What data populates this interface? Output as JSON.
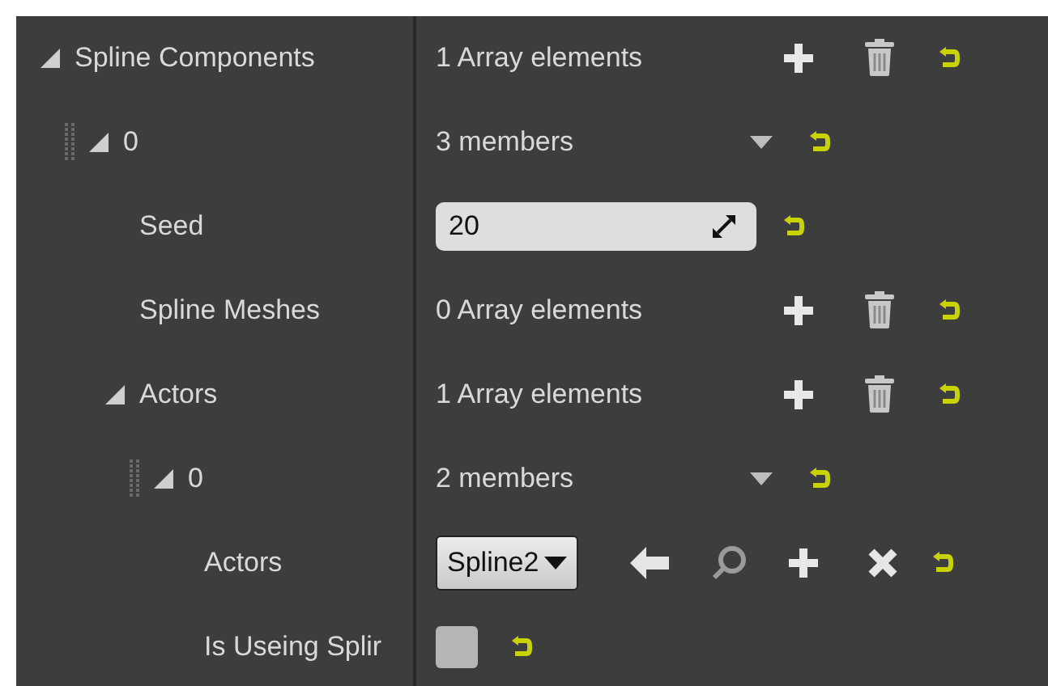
{
  "rows": [
    {
      "label": "Spline Components",
      "kind": "array",
      "expanded": true,
      "value": "1 Array elements",
      "children": [
        {
          "label": "0",
          "kind": "struct",
          "handle": true,
          "expanded": true,
          "value": "3 members",
          "children": [
            {
              "label": "Seed",
              "kind": "number",
              "value": "20"
            },
            {
              "label": "Spline Meshes",
              "kind": "array",
              "value": "0 Array elements"
            },
            {
              "label": "Actors",
              "kind": "array",
              "expanded": true,
              "value": "1 Array elements",
              "children": [
                {
                  "label": "0",
                  "kind": "struct",
                  "handle": true,
                  "expanded": true,
                  "value": "2 members",
                  "children": [
                    {
                      "label": "Actors",
                      "kind": "object",
                      "value": "Spline2"
                    },
                    {
                      "label": "Is Useing Splir",
                      "kind": "checkbox",
                      "checked": false
                    }
                  ]
                }
              ]
            }
          ]
        }
      ]
    }
  ]
}
